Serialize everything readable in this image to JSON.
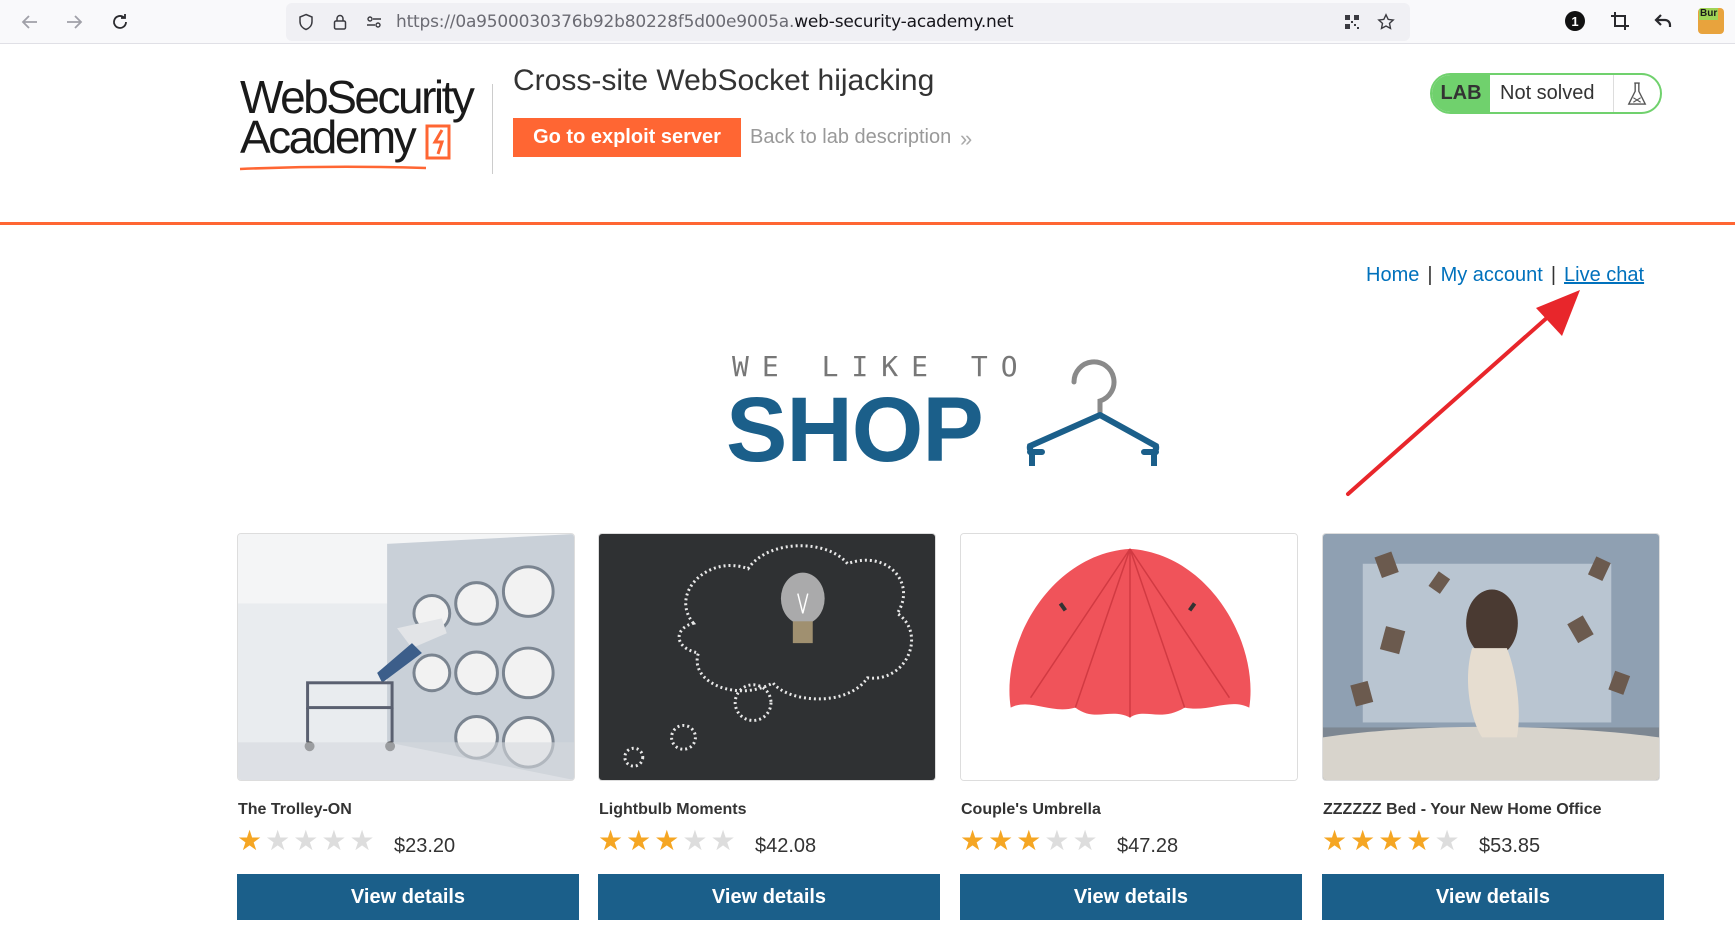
{
  "browser": {
    "url_prefix": "https://0a9500030376b92b80228f5d00e9005a.",
    "url_domain": "web-security-academy.net",
    "extension_badge": "1",
    "burp_label": "Bur"
  },
  "lab": {
    "logo_line1": "WebSecurity",
    "logo_line2": "Academy",
    "title": "Cross-site WebSocket hijacking",
    "exploit_button": "Go to exploit server",
    "back_link": "Back to lab description",
    "back_chevrons": "»",
    "status_tag": "LAB",
    "status_text": "Not solved"
  },
  "nav": {
    "home": "Home",
    "sep": "|",
    "my_account": "My account",
    "live_chat": "Live chat"
  },
  "banner": {
    "top": "WE LIKE TO",
    "main": "SHOP"
  },
  "products": [
    {
      "name": "The Trolley-ON",
      "rating": 1,
      "price": "$23.20",
      "button": "View details"
    },
    {
      "name": "Lightbulb Moments",
      "rating": 3,
      "price": "$42.08",
      "button": "View details"
    },
    {
      "name": "Couple's Umbrella",
      "rating": 3,
      "price": "$47.28",
      "button": "View details"
    },
    {
      "name": "ZZZZZZ Bed - Your New Home Office",
      "rating": 4,
      "price": "$53.85",
      "button": "View details"
    }
  ],
  "colors": {
    "accent_orange": "#ff6633",
    "brand_blue": "#1b5f8a",
    "link_blue": "#0071bc",
    "lab_green": "#70d16d",
    "star_gold": "#f5a623",
    "annotation_red": "#e8262b"
  },
  "icons": {
    "back": "arrow-left-icon",
    "forward": "arrow-right-icon",
    "reload": "reload-icon",
    "shield": "shield-icon",
    "lock": "lock-icon",
    "permissions": "permissions-icon",
    "qr": "qr-code-icon",
    "bookmark": "star-icon",
    "flask": "flask-icon",
    "hanger": "hanger-icon"
  }
}
